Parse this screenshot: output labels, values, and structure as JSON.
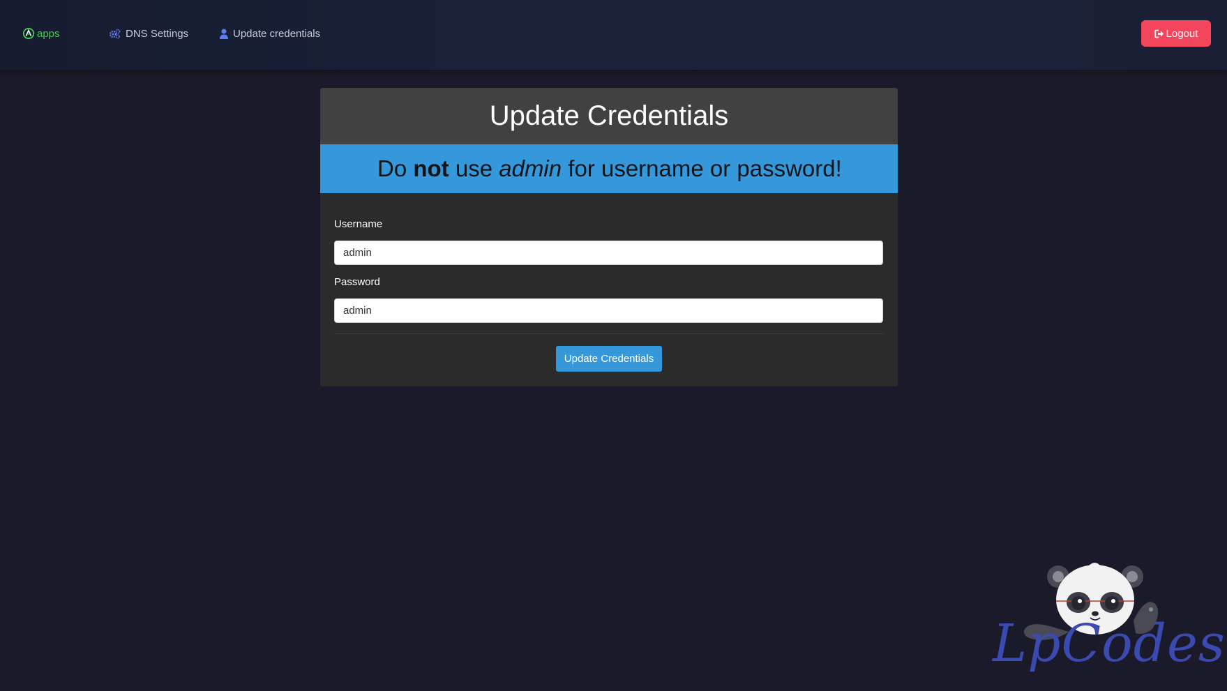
{
  "navbar": {
    "brand_label": "apps",
    "links": [
      {
        "label": "DNS Settings",
        "icon": "gears-icon"
      },
      {
        "label": "Update credentials",
        "icon": "user-icon"
      }
    ],
    "logout_label": "Logout",
    "logout_icon": "sign-out-icon",
    "colors": {
      "brand": "#3fcf4a",
      "logout": "#f3465d",
      "icon_accent": "#5b7ef0"
    }
  },
  "card": {
    "title": "Update Credentials",
    "alert": {
      "prefix": "Do",
      "bold": "not",
      "middle": "use",
      "italic": "admin",
      "suffix": "for username or password!"
    },
    "username": {
      "label": "Username",
      "value": "admin"
    },
    "password": {
      "label": "Password",
      "value": "admin"
    },
    "submit_label": "Update Credentials",
    "colors": {
      "alert_bg": "#3498db",
      "button_bg": "#3498db"
    }
  },
  "watermark": {
    "text": "LpCodes"
  }
}
